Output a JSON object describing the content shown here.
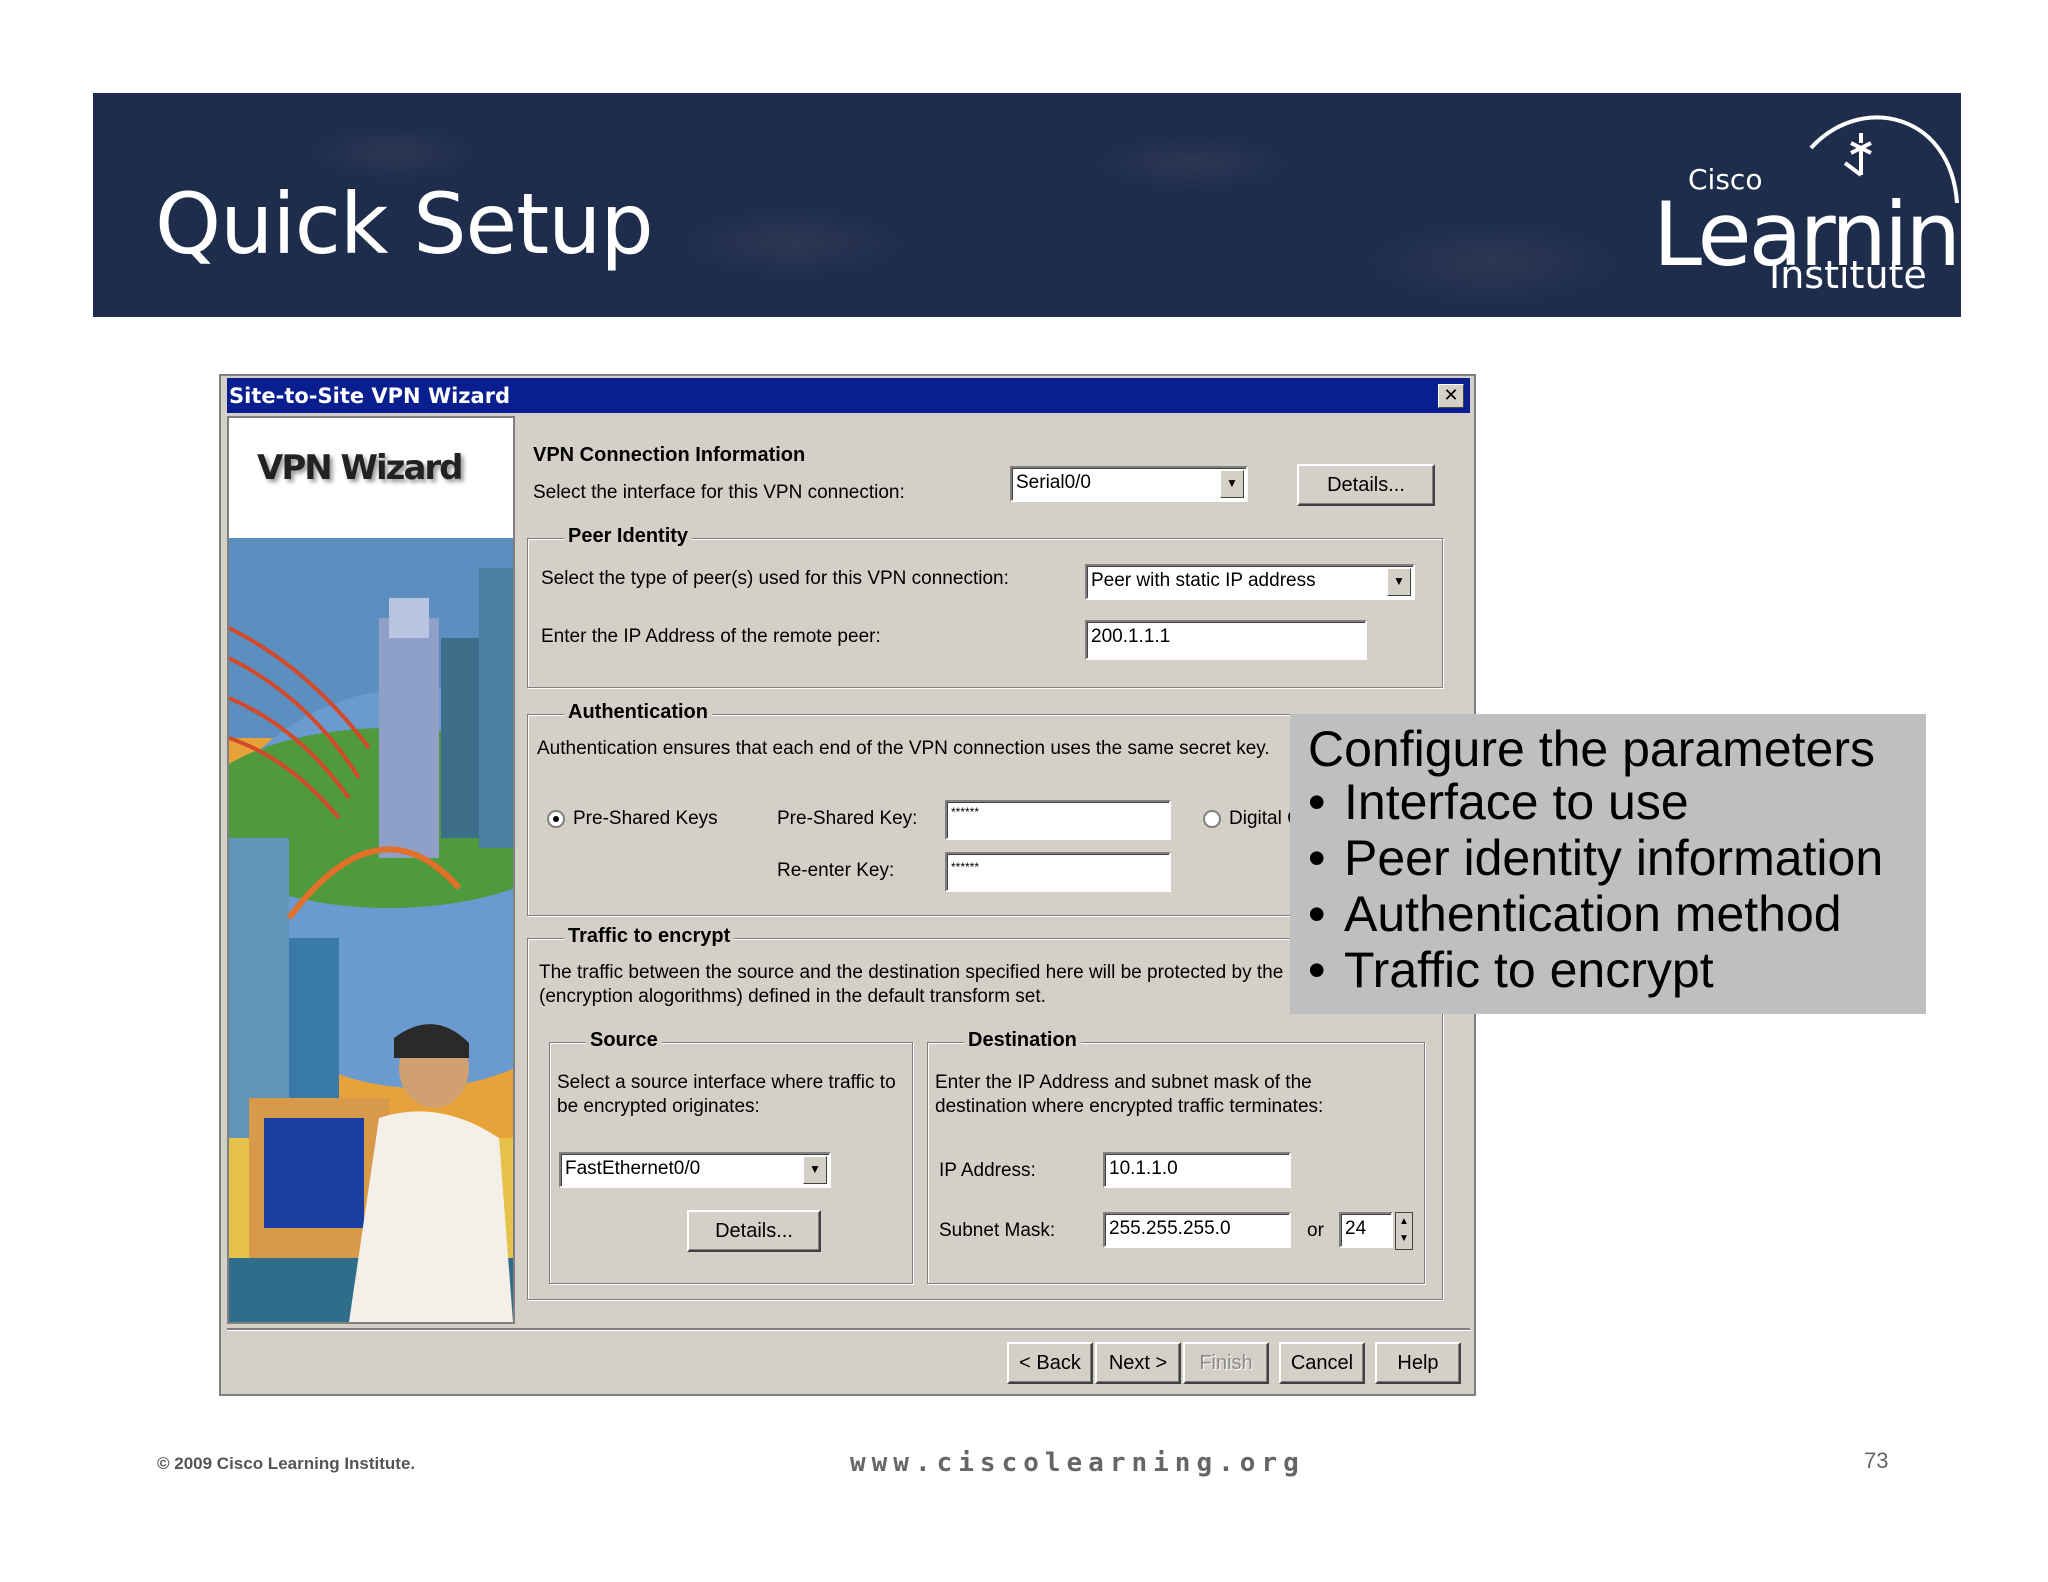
{
  "slide": {
    "title": "Quick Setup",
    "logo": {
      "top": "Cisco",
      "main": "Learning",
      "bottom": "Institute"
    },
    "footer_left": "© 2009 Cisco Learning Institute.",
    "footer_center": "www.ciscolearning.org",
    "page_number": "73"
  },
  "dialog": {
    "title": "Site-to-Site VPN Wizard",
    "close": "✕",
    "side_title": "VPN Wizard",
    "conn": {
      "heading": "VPN Connection Information",
      "label": "Select the interface for this VPN connection:",
      "interface_value": "Serial0/0",
      "details_button": "Details..."
    },
    "peer": {
      "legend": "Peer Identity",
      "type_label": "Select the type of peer(s) used for this VPN connection:",
      "type_value": "Peer with static IP address",
      "ip_label": "Enter the IP Address of the remote peer:",
      "ip_value": "200.1.1.1"
    },
    "auth": {
      "legend": "Authentication",
      "description": "Authentication ensures that each end of the VPN connection uses the same secret key.",
      "psk_radio": "Pre-Shared Keys",
      "psk_label": "Pre-Shared Key:",
      "psk_value": "******",
      "reenter_label": "Re-enter Key:",
      "reenter_value": "******",
      "digital_radio": "Digital C"
    },
    "traffic": {
      "legend": "Traffic to encrypt",
      "desc1": "The traffic between the source and the destination specified here will be protected by the",
      "desc2": "(encryption alogorithms) defined in the default transform set.",
      "source": {
        "legend": "Source",
        "desc1": "Select a source interface where traffic to",
        "desc2": "be encrypted originates:",
        "interface_value": "FastEthernet0/0",
        "details_button": "Details..."
      },
      "destination": {
        "legend": "Destination",
        "desc1": "Enter the IP Address and subnet mask of the",
        "desc2": "destination where encrypted traffic terminates:",
        "ip_label": "IP Address:",
        "ip_value": "10.1.1.0",
        "mask_label": "Subnet Mask:",
        "mask_value": "255.255.255.0",
        "or_label": "or",
        "prefix_value": "24"
      }
    },
    "buttons": {
      "back": "< Back",
      "next": "Next >",
      "finish": "Finish",
      "cancel": "Cancel",
      "help": "Help"
    }
  },
  "callout": {
    "heading": "Configure the parameters",
    "items": [
      "Interface to use",
      "Peer identity information",
      "Authentication method",
      "Traffic to encrypt"
    ]
  },
  "colors": {
    "banner": "#1f2d4c",
    "titlebar": "#0a1f8f",
    "dialog_bg": "#d4d0c8",
    "callout_bg": "#bfbfbf"
  }
}
